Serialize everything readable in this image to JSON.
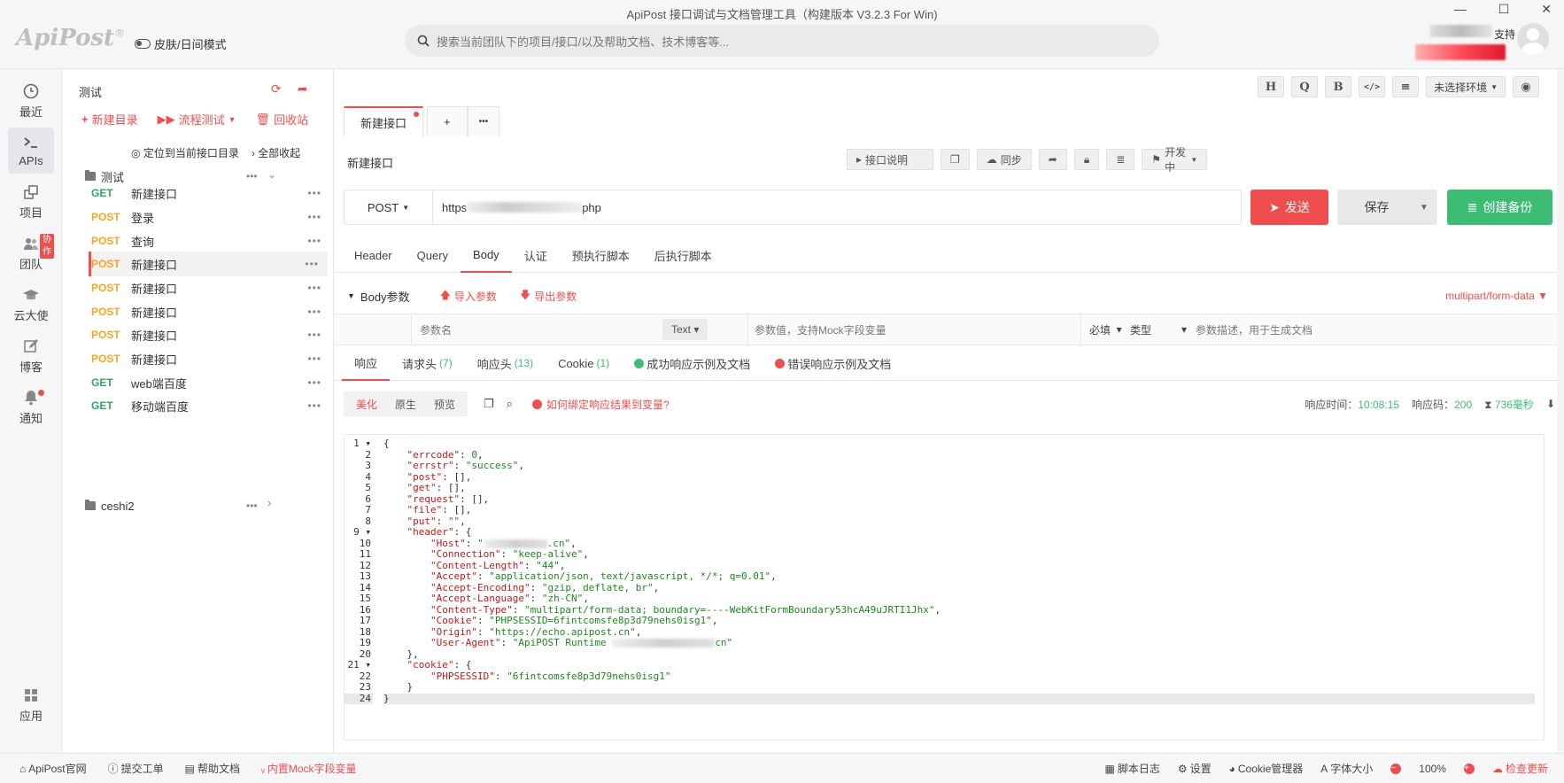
{
  "window": {
    "title": "ApiPost 接口调试与文档管理工具（构建版本 V3.2.3 For Win)",
    "controls": [
      "—",
      "☐",
      "✕"
    ]
  },
  "header": {
    "logo": "ApiPost",
    "logo_mark": "®",
    "skin_mode": "皮肤/日间模式",
    "search_placeholder": "搜索当前团队下的项目/接口/以及帮助文档、技术博客等...",
    "support_suffix": "支持"
  },
  "rail": {
    "items": [
      {
        "label": "最近",
        "icon": "clock-icon"
      },
      {
        "label": "APIs",
        "icon": "terminal-icon"
      },
      {
        "label": "项目",
        "icon": "project-icon"
      },
      {
        "label": "团队",
        "icon": "team-icon",
        "badge": "协作"
      },
      {
        "label": "云大使",
        "icon": "graduation-cap-icon"
      },
      {
        "label": "博客",
        "icon": "edit-icon"
      },
      {
        "label": "通知",
        "icon": "bell-icon"
      },
      {
        "label": "应用",
        "icon": "apps-grid-icon"
      }
    ]
  },
  "tree": {
    "title": "测试",
    "actions": {
      "new_dir": "新建目录",
      "flow_test": "流程测试",
      "recycle": "回收站"
    },
    "locate": "定位到当前接口目录",
    "collapse_all": "全部收起",
    "folders": [
      {
        "name": "测试"
      },
      {
        "name": "ceshi2"
      }
    ],
    "items": [
      {
        "method": "GET",
        "name": "新建接口"
      },
      {
        "method": "POST",
        "name": "登录"
      },
      {
        "method": "POST",
        "name": "查询"
      },
      {
        "method": "POST",
        "name": "新建接口"
      },
      {
        "method": "POST",
        "name": "新建接口"
      },
      {
        "method": "POST",
        "name": "新建接口"
      },
      {
        "method": "POST",
        "name": "新建接口"
      },
      {
        "method": "POST",
        "name": "新建接口"
      },
      {
        "method": "GET",
        "name": "web端百度"
      },
      {
        "method": "GET",
        "name": "移动端百度"
      }
    ],
    "dots": "•••"
  },
  "main": {
    "top_icons": [
      "H",
      "Q",
      "B",
      "</>",
      "≡"
    ],
    "env_select": "未选择环境",
    "tabs": [
      {
        "label": "新建接口"
      }
    ],
    "tab_add": "+",
    "tab_more": "•••",
    "api_title": "新建接口",
    "api_tools": {
      "doc": "接口说明",
      "sync": "同步",
      "status": "开发中"
    },
    "method": "POST",
    "url_prefix": "https",
    "url_suffix": "php",
    "send": "发送",
    "save": "保存",
    "backup": "创建备份",
    "req_tabs": [
      "Header",
      "Query",
      "Body",
      "认证",
      "预执行脚本",
      "后执行脚本"
    ],
    "body": {
      "title": "Body参数",
      "import": "导入参数",
      "export": "导出参数",
      "content_type": "multipart/form-data",
      "param_name_ph": "参数名",
      "param_type": "Text",
      "param_value_ph": "参数值，支持Mock字段变量",
      "required": "必填",
      "type": "类型",
      "desc_ph": "参数描述，用于生成文档"
    },
    "resp_tabs": [
      {
        "label": "响应",
        "count": ""
      },
      {
        "label": "请求头",
        "count": "(7)"
      },
      {
        "label": "响应头",
        "count": "(13)"
      },
      {
        "label": "Cookie",
        "count": "(1)"
      },
      {
        "label": "成功响应示例及文档",
        "count": ""
      },
      {
        "label": "错误响应示例及文档",
        "count": ""
      }
    ],
    "view_modes": [
      "美化",
      "原生",
      "预览"
    ],
    "bind_help": "如何绑定响应结果到变量?",
    "stats": {
      "time_label": "响应时间：",
      "time_value": "10:08:15",
      "code_label": "响应码：",
      "code_value": "200",
      "duration": "736毫秒"
    }
  },
  "status_bar": {
    "left": [
      "ApiPost官网",
      "提交工单",
      "帮助文档",
      "内置Mock字段变量"
    ],
    "right": [
      "脚本日志",
      "设置",
      "Cookie管理器",
      "字体大小",
      "100%",
      "检查更新"
    ]
  }
}
